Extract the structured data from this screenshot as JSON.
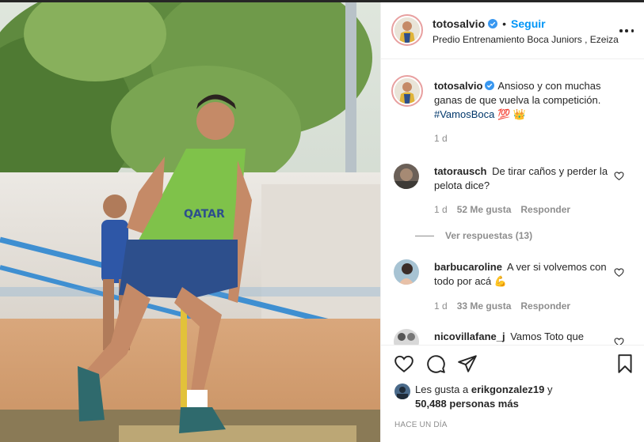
{
  "post": {
    "author": "totosalvio",
    "follow_label": "Seguir",
    "separator": "•",
    "location": "Predio Entrenamiento Boca Juniors , Ezeiza",
    "caption_text": "Ansioso y con muchas ganas de que vuelva la competición.",
    "caption_tag": "#VamosBoca",
    "caption_emojis": "💯 👑",
    "caption_age": "1 d",
    "likes_prefix": "Les gusta a",
    "likes_user": "erikgonzalez19",
    "likes_conj": "y",
    "likes_count": "50,488 personas más",
    "time_ago": "HACE UN DÍA"
  },
  "comments": [
    {
      "user": "tatorausch",
      "text": "De tirar caños y perder la pelota dice?",
      "age": "1 d",
      "likes": "52 Me gusta",
      "reply": "Responder",
      "view_replies": "Ver respuestas (13)"
    },
    {
      "user": "barbucaroline",
      "text": "A ver si volvemos con todo por acá",
      "emoji": "💪",
      "age": "1 d",
      "likes": "33 Me gusta",
      "reply": "Responder"
    },
    {
      "user": "nicovillafane_j",
      "text": "Vamos Toto que"
    }
  ],
  "icons": {
    "verified": "verified-badge-icon",
    "more": "more-options-icon",
    "like": "heart-icon",
    "comment": "comment-bubble-icon",
    "share": "send-paper-plane-icon",
    "save": "bookmark-icon"
  },
  "colors": {
    "link_blue": "#0095f6",
    "text": "#262626",
    "muted": "#8e8e8e",
    "verified": "#3897f0"
  }
}
